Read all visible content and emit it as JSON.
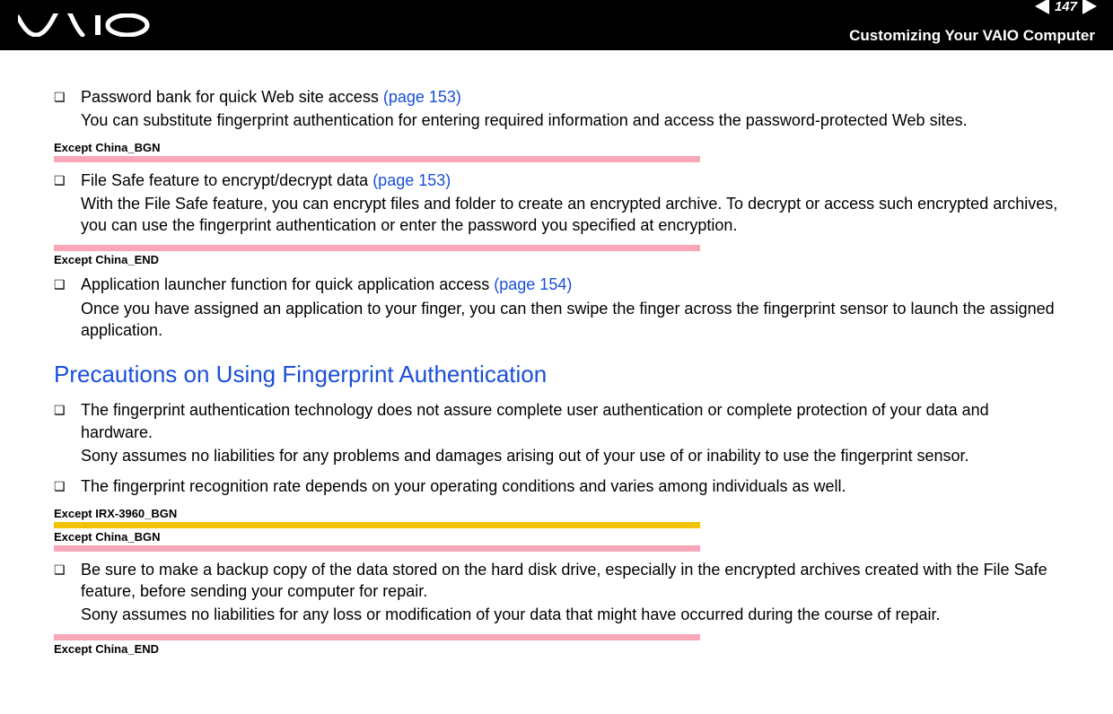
{
  "header": {
    "page_number": "147",
    "nav_label": "n N",
    "title": "Customizing Your VAIO Computer"
  },
  "items": {
    "pw_title": "Password bank for quick Web site access ",
    "pw_ref": "(page 153)",
    "pw_desc": "You can substitute fingerprint authentication for entering required information and access the password-protected Web sites.",
    "fs_title": "File Safe feature to encrypt/decrypt data ",
    "fs_ref": "(page 153)",
    "fs_desc": "With the File Safe feature, you can encrypt files and folder to create an encrypted archive. To decrypt or access such encrypted archives, you can use the fingerprint authentication or enter the password you specified at encryption.",
    "al_title": "Application launcher function for quick application access ",
    "al_ref": "(page 154)",
    "al_desc": "Once you have assigned an application to your finger, you can then swipe the finger across the fingerprint sensor to launch the assigned application."
  },
  "markers": {
    "china_bgn": "Except China_BGN",
    "china_end": "Except China_END",
    "irx_bgn": "Except IRX-3960_BGN"
  },
  "section_heading": "Precautions on Using Fingerprint Authentication",
  "precautions": {
    "p1a": "The fingerprint authentication technology does not assure complete user authentication or complete protection of your data and hardware.",
    "p1b": "Sony assumes no liabilities for any problems and damages arising out of your use of or inability to use the fingerprint sensor.",
    "p2": "The fingerprint recognition rate depends on your operating conditions and varies among individuals as well.",
    "p3a": "Be sure to make a backup copy of the data stored on the hard disk drive, especially in the encrypted archives created with the File Safe feature, before sending your computer for repair.",
    "p3b": "Sony assumes no liabilities for any loss or modification of your data that might have occurred during the course of repair."
  }
}
